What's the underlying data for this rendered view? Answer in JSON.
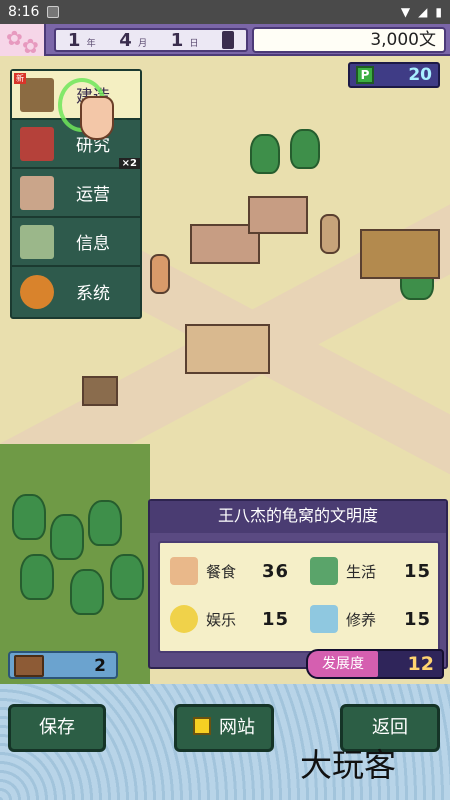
{
  "status_bar": {
    "time": "8:16"
  },
  "top_bar": {
    "year": "1",
    "year_unit": "年",
    "month": "4",
    "month_unit": "月",
    "day": "1",
    "day_unit": "日",
    "money": "3,000文"
  },
  "points": {
    "value": "20",
    "icon": "P"
  },
  "menu": {
    "items": [
      {
        "label": "建造",
        "badge": "新"
      },
      {
        "label": "研究",
        "multiplier": "×2"
      },
      {
        "label": "运营"
      },
      {
        "label": "信息"
      },
      {
        "label": "系统"
      }
    ]
  },
  "civilization": {
    "title": "王八杰的龟窝的文明度",
    "stats": [
      {
        "label": "餐食",
        "value": "36"
      },
      {
        "label": "生活",
        "value": "15"
      },
      {
        "label": "娱乐",
        "value": "15"
      },
      {
        "label": "修养",
        "value": "15"
      }
    ]
  },
  "storage": {
    "value": "2"
  },
  "development": {
    "label": "发展度",
    "value": "12"
  },
  "buttons": {
    "save": "保存",
    "website": "网站",
    "back": "返回"
  },
  "watermark": "大玩客",
  "colors": {
    "menu_bg": "#2e5a4c",
    "topbar": "#7b66a8",
    "panel": "#5a4a82",
    "button": "#2c5e45"
  }
}
